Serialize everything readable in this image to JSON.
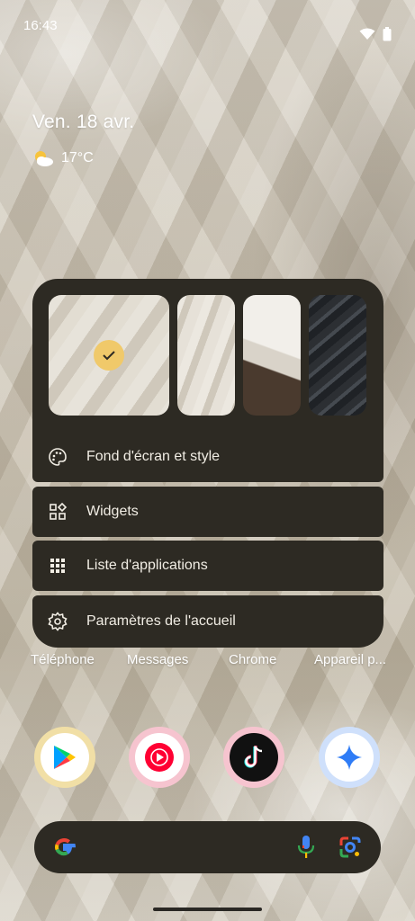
{
  "status_bar": {
    "time": "16:43"
  },
  "date_widget": {
    "date": "Ven. 18 avr.",
    "temperature": "17°C",
    "weather_icon": "partly-cloudy-icon"
  },
  "popup": {
    "wallpaper_previews": [
      "current",
      "fabric",
      "feathers-white",
      "feathers-dark"
    ],
    "selected_index": 0,
    "items": [
      {
        "label": "Fond d'écran et style",
        "icon": "palette-icon"
      },
      {
        "label": "Widgets",
        "icon": "widgets-icon"
      },
      {
        "label": "Liste d'applications",
        "icon": "app-grid-icon"
      },
      {
        "label": "Paramètres de l'accueil",
        "icon": "gear-icon"
      }
    ]
  },
  "dock": {
    "labels": [
      "Téléphone",
      "Messages",
      "Chrome",
      "Appareil p..."
    ]
  },
  "apps": [
    {
      "name": "play-store-icon"
    },
    {
      "name": "youtube-music-icon"
    },
    {
      "name": "tiktok-icon"
    },
    {
      "name": "gemini-icon"
    }
  ],
  "colors": {
    "accent": "#f0c96a",
    "panel": "#2d2a23"
  }
}
